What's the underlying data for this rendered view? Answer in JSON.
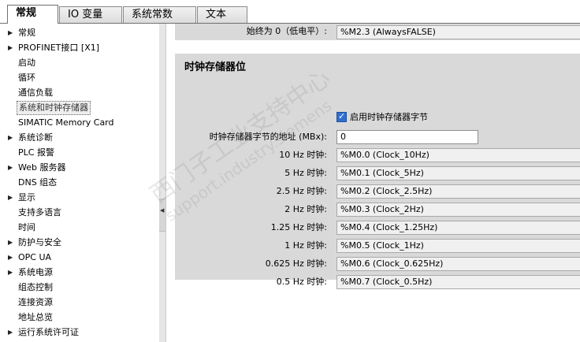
{
  "tabs": [
    {
      "label": "常规",
      "active": true
    },
    {
      "label": "IO 变量",
      "active": false
    },
    {
      "label": "系统常数",
      "active": false
    },
    {
      "label": "文本",
      "active": false
    }
  ],
  "tree": [
    {
      "label": "常规",
      "expandable": true
    },
    {
      "label": "PROFINET接口 [X1]",
      "expandable": true
    },
    {
      "label": "启动",
      "expandable": false
    },
    {
      "label": "循环",
      "expandable": false
    },
    {
      "label": "通信负载",
      "expandable": false
    },
    {
      "label": "系统和时钟存储器",
      "expandable": false,
      "selected": true
    },
    {
      "label": "SIMATIC Memory Card",
      "expandable": false
    },
    {
      "label": "系统诊断",
      "expandable": true
    },
    {
      "label": "PLC 报警",
      "expandable": false
    },
    {
      "label": "Web 服务器",
      "expandable": true
    },
    {
      "label": "DNS 组态",
      "expandable": false
    },
    {
      "label": "显示",
      "expandable": true
    },
    {
      "label": "支持多语言",
      "expandable": false
    },
    {
      "label": "时间",
      "expandable": false
    },
    {
      "label": "防护与安全",
      "expandable": true
    },
    {
      "label": "OPC UA",
      "expandable": true
    },
    {
      "label": "系统电源",
      "expandable": true
    },
    {
      "label": "组态控制",
      "expandable": false
    },
    {
      "label": "连接资源",
      "expandable": false
    },
    {
      "label": "地址总览",
      "expandable": false
    },
    {
      "label": "运行系统许可证",
      "expandable": true
    }
  ],
  "top_row": {
    "label": "始终为 0（低电平）:",
    "value": "%M2.3 (AlwaysFALSE)"
  },
  "section": {
    "title": "时钟存储器位",
    "enable_checkbox": {
      "label": "启用时钟存储器字节",
      "checked": true
    },
    "address": {
      "label": "时钟存储器字节的地址 (MBx):",
      "value": "0"
    },
    "clocks": [
      {
        "label": "10 Hz 时钟:",
        "value": "%M0.0 (Clock_10Hz)"
      },
      {
        "label": "5 Hz 时钟:",
        "value": "%M0.1 (Clock_5Hz)"
      },
      {
        "label": "2.5 Hz 时钟:",
        "value": "%M0.2 (Clock_2.5Hz)"
      },
      {
        "label": "2 Hz 时钟:",
        "value": "%M0.3 (Clock_2Hz)"
      },
      {
        "label": "1.25 Hz 时钟:",
        "value": "%M0.4 (Clock_1.25Hz)"
      },
      {
        "label": "1 Hz 时钟:",
        "value": "%M0.5 (Clock_1Hz)"
      },
      {
        "label": "0.625 Hz 时钟:",
        "value": "%M0.6 (Clock_0.625Hz)"
      },
      {
        "label": "0.5 Hz 时钟:",
        "value": "%M0.7 (Clock_0.5Hz)"
      }
    ]
  },
  "watermark": {
    "line1": "西门子工业支持中心",
    "line2": "support.industry.siemens"
  },
  "icons": {
    "expand": "triangle-right-icon",
    "splitter": "triangle-left-icon",
    "checkbox": "checkmark-icon"
  }
}
